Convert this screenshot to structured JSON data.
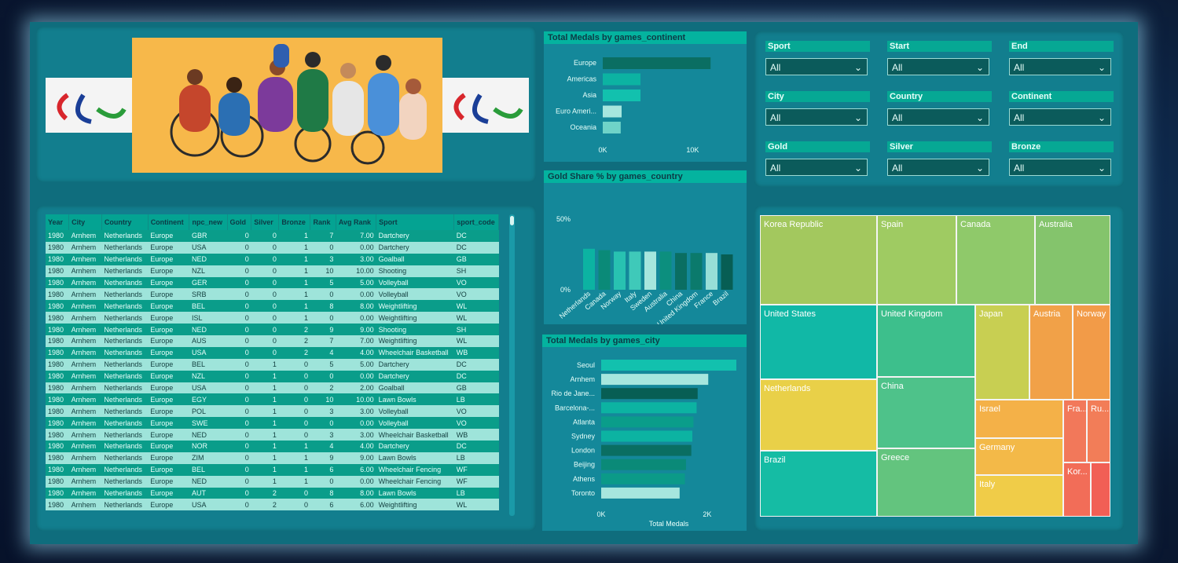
{
  "header": {
    "logo_label": "paralympic-logo"
  },
  "charts": {
    "continent": {
      "title": "Total Medals by games_continent",
      "categories": [
        "Europe",
        "Americas",
        "Asia",
        "Euro Ameri...",
        "Oceania"
      ],
      "values": [
        12000,
        4200,
        4200,
        2100,
        2000
      ],
      "colors": [
        "#0a6e62",
        "#0cb3a2",
        "#12c1ae",
        "#a6e6de",
        "#6fd3c8"
      ],
      "xticks": [
        "0K",
        "10K"
      ]
    },
    "gold_share": {
      "title": "Gold Share % by games_country",
      "categories": [
        "Netherlands",
        "Canada",
        "Norway",
        "Italy",
        "Sweden",
        "Australia",
        "China",
        "United Kingdom",
        "France",
        "Brazil"
      ],
      "values": [
        0.29,
        0.28,
        0.27,
        0.27,
        0.27,
        0.27,
        0.26,
        0.26,
        0.26,
        0.25
      ],
      "colors": [
        "#0cb3a2",
        "#0a8a78",
        "#28c2b1",
        "#3fc9b9",
        "#a6e6de",
        "#0c8f7e",
        "#0a6e62",
        "#0b7a6c",
        "#98dfd7",
        "#075e54"
      ],
      "yticks": [
        "50%",
        "0%"
      ]
    },
    "city": {
      "title": "Total Medals by games_city",
      "categories": [
        "Seoul",
        "Arnhem",
        "Rio de Jane...",
        "Barcelona-...",
        "Atlanta",
        "Sydney",
        "London",
        "Beijing",
        "Athens",
        "Toronto"
      ],
      "values": [
        2550,
        2020,
        1820,
        1800,
        1740,
        1720,
        1700,
        1600,
        1580,
        1480
      ],
      "colors": [
        "#12c1ae",
        "#a6e6de",
        "#075e54",
        "#0cb3a2",
        "#0a9d8a",
        "#0cb3a2",
        "#0a6e62",
        "#0a8a78",
        "#0b9a88",
        "#a6e6de"
      ],
      "xticks": [
        "0K",
        "2K"
      ],
      "xlabel": "Total Medals"
    }
  },
  "slicers": [
    {
      "label": "Sport",
      "value": "All"
    },
    {
      "label": "Start",
      "value": "All"
    },
    {
      "label": "End",
      "value": "All"
    },
    {
      "label": "City",
      "value": "All"
    },
    {
      "label": "Country",
      "value": "All"
    },
    {
      "label": "Continent",
      "value": "All"
    },
    {
      "label": "Gold",
      "value": "All"
    },
    {
      "label": "Silver",
      "value": "All"
    },
    {
      "label": "Bronze",
      "value": "All"
    }
  ],
  "table": {
    "columns": [
      "Year",
      "City",
      "Country",
      "Continent",
      "npc_new",
      "Gold",
      "Silver",
      "Bronze",
      "Rank",
      "Avg Rank",
      "Sport",
      "sport_code"
    ],
    "rows": [
      [
        "1980",
        "Arnhem",
        "Netherlands",
        "Europe",
        "GBR",
        "0",
        "0",
        "1",
        "7",
        "7.00",
        "Dartchery",
        "DC"
      ],
      [
        "1980",
        "Arnhem",
        "Netherlands",
        "Europe",
        "USA",
        "0",
        "0",
        "1",
        "0",
        "0.00",
        "Dartchery",
        "DC"
      ],
      [
        "1980",
        "Arnhem",
        "Netherlands",
        "Europe",
        "NED",
        "0",
        "0",
        "1",
        "3",
        "3.00",
        "Goalball",
        "GB"
      ],
      [
        "1980",
        "Arnhem",
        "Netherlands",
        "Europe",
        "NZL",
        "0",
        "0",
        "1",
        "10",
        "10.00",
        "Shooting",
        "SH"
      ],
      [
        "1980",
        "Arnhem",
        "Netherlands",
        "Europe",
        "GER",
        "0",
        "0",
        "1",
        "5",
        "5.00",
        "Volleyball",
        "VO"
      ],
      [
        "1980",
        "Arnhem",
        "Netherlands",
        "Europe",
        "SRB",
        "0",
        "0",
        "1",
        "0",
        "0.00",
        "Volleyball",
        "VO"
      ],
      [
        "1980",
        "Arnhem",
        "Netherlands",
        "Europe",
        "BEL",
        "0",
        "0",
        "1",
        "8",
        "8.00",
        "Weightlifting",
        "WL"
      ],
      [
        "1980",
        "Arnhem",
        "Netherlands",
        "Europe",
        "ISL",
        "0",
        "0",
        "1",
        "0",
        "0.00",
        "Weightlifting",
        "WL"
      ],
      [
        "1980",
        "Arnhem",
        "Netherlands",
        "Europe",
        "NED",
        "0",
        "0",
        "2",
        "9",
        "9.00",
        "Shooting",
        "SH"
      ],
      [
        "1980",
        "Arnhem",
        "Netherlands",
        "Europe",
        "AUS",
        "0",
        "0",
        "2",
        "7",
        "7.00",
        "Weightlifting",
        "WL"
      ],
      [
        "1980",
        "Arnhem",
        "Netherlands",
        "Europe",
        "USA",
        "0",
        "0",
        "2",
        "4",
        "4.00",
        "Wheelchair Basketball",
        "WB"
      ],
      [
        "1980",
        "Arnhem",
        "Netherlands",
        "Europe",
        "BEL",
        "0",
        "1",
        "0",
        "5",
        "5.00",
        "Dartchery",
        "DC"
      ],
      [
        "1980",
        "Arnhem",
        "Netherlands",
        "Europe",
        "NZL",
        "0",
        "1",
        "0",
        "0",
        "0.00",
        "Dartchery",
        "DC"
      ],
      [
        "1980",
        "Arnhem",
        "Netherlands",
        "Europe",
        "USA",
        "0",
        "1",
        "0",
        "2",
        "2.00",
        "Goalball",
        "GB"
      ],
      [
        "1980",
        "Arnhem",
        "Netherlands",
        "Europe",
        "EGY",
        "0",
        "1",
        "0",
        "10",
        "10.00",
        "Lawn Bowls",
        "LB"
      ],
      [
        "1980",
        "Arnhem",
        "Netherlands",
        "Europe",
        "POL",
        "0",
        "1",
        "0",
        "3",
        "3.00",
        "Volleyball",
        "VO"
      ],
      [
        "1980",
        "Arnhem",
        "Netherlands",
        "Europe",
        "SWE",
        "0",
        "1",
        "0",
        "0",
        "0.00",
        "Volleyball",
        "VO"
      ],
      [
        "1980",
        "Arnhem",
        "Netherlands",
        "Europe",
        "NED",
        "0",
        "1",
        "0",
        "3",
        "3.00",
        "Wheelchair Basketball",
        "WB"
      ],
      [
        "1980",
        "Arnhem",
        "Netherlands",
        "Europe",
        "NOR",
        "0",
        "1",
        "1",
        "4",
        "4.00",
        "Dartchery",
        "DC"
      ],
      [
        "1980",
        "Arnhem",
        "Netherlands",
        "Europe",
        "ZIM",
        "0",
        "1",
        "1",
        "9",
        "9.00",
        "Lawn Bowls",
        "LB"
      ],
      [
        "1980",
        "Arnhem",
        "Netherlands",
        "Europe",
        "BEL",
        "0",
        "1",
        "1",
        "6",
        "6.00",
        "Wheelchair Fencing",
        "WF"
      ],
      [
        "1980",
        "Arnhem",
        "Netherlands",
        "Europe",
        "NED",
        "0",
        "1",
        "1",
        "0",
        "0.00",
        "Wheelchair Fencing",
        "WF"
      ],
      [
        "1980",
        "Arnhem",
        "Netherlands",
        "Europe",
        "AUT",
        "0",
        "2",
        "0",
        "8",
        "8.00",
        "Lawn Bowls",
        "LB"
      ],
      [
        "1980",
        "Arnhem",
        "Netherlands",
        "Europe",
        "USA",
        "0",
        "2",
        "0",
        "6",
        "6.00",
        "Weightlifting",
        "WL"
      ]
    ]
  },
  "treemap": {
    "items": [
      {
        "label": "Korea Republic",
        "color": "#a3c85e"
      },
      {
        "label": "Spain",
        "color": "#9fcb62"
      },
      {
        "label": "Canada",
        "color": "#8fc96a"
      },
      {
        "label": "Australia",
        "color": "#84c46c"
      },
      {
        "label": "United States",
        "color": "#11b8a6"
      },
      {
        "label": "United Kingdom",
        "color": "#3dbf8c"
      },
      {
        "label": "Japan",
        "color": "#c8cf52"
      },
      {
        "label": "Austria",
        "color": "#f1a148"
      },
      {
        "label": "Norway",
        "color": "#f29b48"
      },
      {
        "label": "Netherlands",
        "color": "#e9d048"
      },
      {
        "label": "China",
        "color": "#4ec28a"
      },
      {
        "label": "Israel",
        "color": "#f4b148"
      },
      {
        "label": "Fra...",
        "color": "#f2785a"
      },
      {
        "label": "Ru...",
        "color": "#f27d58"
      },
      {
        "label": "Germany",
        "color": "#f3b948"
      },
      {
        "label": "Kor...",
        "color": "#f26d58"
      },
      {
        "label": "Brazil",
        "color": "#15bca4"
      },
      {
        "label": "Greece",
        "color": "#63c47e"
      },
      {
        "label": "Italy",
        "color": "#f0cc48"
      },
      {
        "label": "",
        "color": "#f15f55"
      }
    ]
  }
}
